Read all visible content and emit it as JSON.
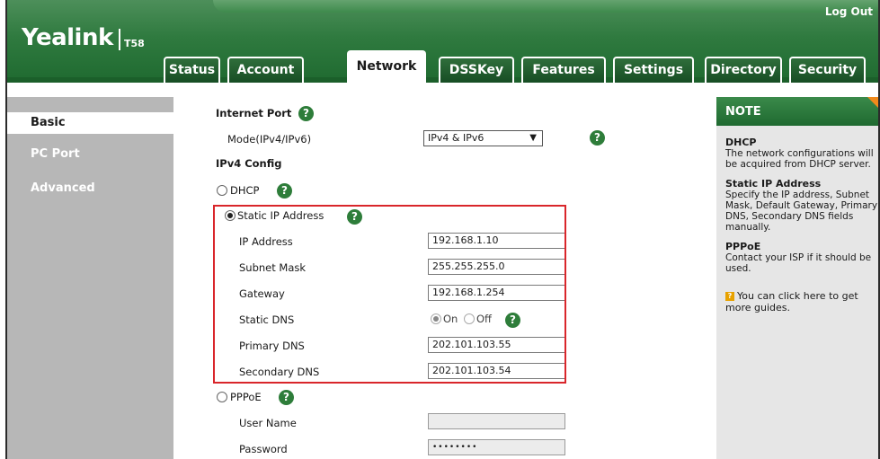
{
  "header": {
    "logo": "Yealink",
    "model": "T58",
    "logout": "Log Out"
  },
  "tabs": [
    {
      "label": "Status"
    },
    {
      "label": "Account"
    },
    {
      "label": "Network"
    },
    {
      "label": "DSSKey"
    },
    {
      "label": "Features"
    },
    {
      "label": "Settings"
    },
    {
      "label": "Directory"
    },
    {
      "label": "Security"
    }
  ],
  "active_tab": "Network",
  "sidebar": {
    "items": [
      {
        "label": "Basic"
      },
      {
        "label": "PC Port"
      },
      {
        "label": "Advanced"
      }
    ],
    "active": "Basic"
  },
  "form": {
    "internet_port": "Internet Port",
    "mode_label": "Mode(IPv4/IPv6)",
    "mode_value": "IPv4 & IPv6",
    "ipv4_config": "IPv4 Config",
    "dhcp": "DHCP",
    "static_ip": "Static IP Address",
    "ip_address_label": "IP Address",
    "ip_address_value": "192.168.1.10",
    "subnet_label": "Subnet Mask",
    "subnet_value": "255.255.255.0",
    "gateway_label": "Gateway",
    "gateway_value": "192.168.1.254",
    "static_dns_label": "Static DNS",
    "static_dns_on": "On",
    "static_dns_off": "Off",
    "primary_dns_label": "Primary DNS",
    "primary_dns_value": "202.101.103.55",
    "secondary_dns_label": "Secondary DNS",
    "secondary_dns_value": "202.101.103.54",
    "pppoe": "PPPoE",
    "username_label": "User Name",
    "username_value": "",
    "password_label": "Password",
    "password_value": "••••••••",
    "help_glyph": "?"
  },
  "note": {
    "title": "NOTE",
    "dhcp_title": "DHCP",
    "dhcp_text": "The network configurations will be acquired from DHCP server.",
    "static_title": "Static IP Address",
    "static_text": "Specify the IP address, Subnet Mask, Default Gateway, Primary DNS, Secondary DNS fields manually.",
    "pppoe_title": "PPPoE",
    "pppoe_text": "Contact your ISP if it should be used.",
    "guide_text": "You can click here to get more guides."
  },
  "colors": {
    "header_green": "#2f7a3f",
    "help_green": "#2e7d3a",
    "highlight_red": "#d9262b",
    "note_corner": "#f08a1c"
  }
}
